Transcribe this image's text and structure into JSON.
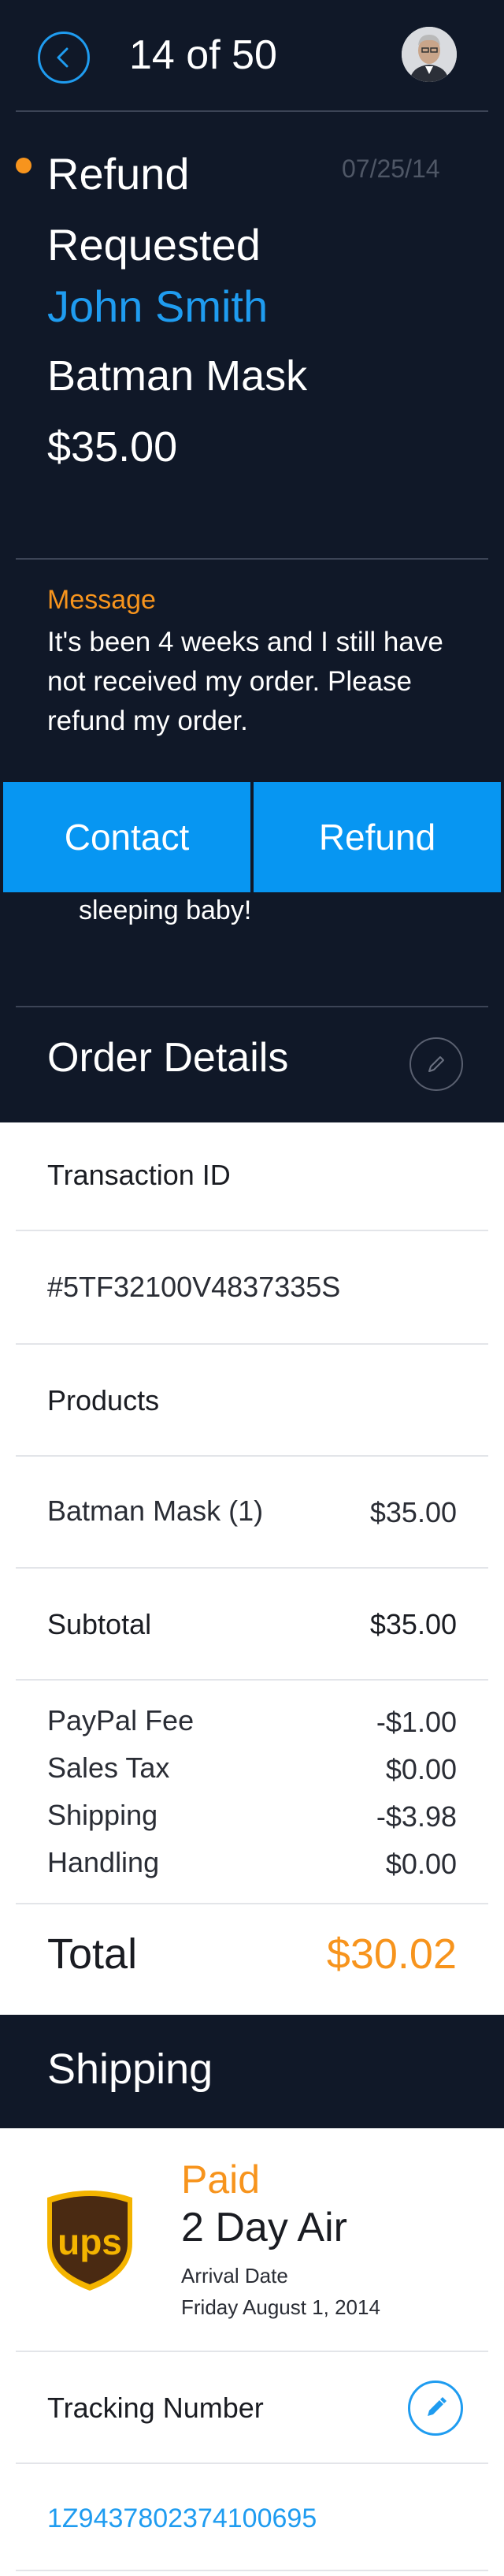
{
  "header": {
    "counter": "14 of 50"
  },
  "request": {
    "status": "Refund Requested",
    "date": "07/25/14",
    "customer_name": "John Smith",
    "product": "Batman Mask",
    "amount": "$35.00"
  },
  "message": {
    "label": "Message",
    "text": "It's been 4 weeks and I still have not received my order. Please refund my order.",
    "partial_text": "sleeping baby!"
  },
  "actions": {
    "contact_label": "Contact",
    "refund_label": "Refund"
  },
  "order_details": {
    "title": "Order Details",
    "transaction_label": "Transaction ID",
    "transaction_id": "#5TF32100V4837335S",
    "products_label": "Products",
    "product_line": {
      "name": "Batman Mask (1)",
      "price": "$35.00"
    },
    "subtotal_label": "Subtotal",
    "subtotal_value": "$35.00",
    "fees": [
      {
        "label": "PayPal Fee",
        "value": "-$1.00"
      },
      {
        "label": "Sales Tax",
        "value": "$0.00"
      },
      {
        "label": "Shipping",
        "value": "-$3.98"
      },
      {
        "label": "Handling",
        "value": "$0.00"
      }
    ],
    "total_label": "Total",
    "total_value": "$30.02"
  },
  "shipping": {
    "title": "Shipping",
    "carrier_logo_text": "ups",
    "status": "Paid",
    "method": "2 Day Air",
    "arrival_label": "Arrival Date",
    "arrival_date": "Friday August 1, 2014",
    "tracking_label": "Tracking Number",
    "tracking_number": "1Z9437802374100695"
  },
  "icons": {
    "back": "chevron-left-icon",
    "edit": "pencil-icon",
    "unread": "dot-icon"
  },
  "colors": {
    "dark_bg": "#101828",
    "accent_blue": "#1f9cf0",
    "button_blue": "#0796f2",
    "accent_orange": "#f7941d"
  }
}
